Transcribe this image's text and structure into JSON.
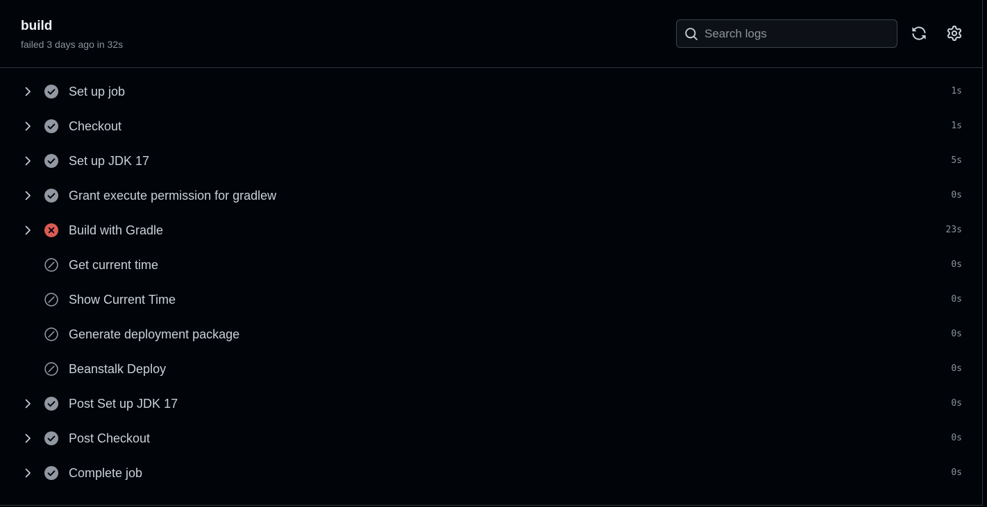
{
  "job": {
    "title": "build",
    "status_text": "failed 3 days ago in 32s"
  },
  "search": {
    "placeholder": "Search logs",
    "value": ""
  },
  "toolbar": {
    "refresh_icon": "sync-icon",
    "settings_icon": "gear-icon"
  },
  "colors": {
    "background": "#010409",
    "success_icon": "#9198a1",
    "failure_icon": "#f85149",
    "skipped_icon": "#9198a1",
    "text": "#c9d1d9",
    "muted": "#8b949e"
  },
  "steps": [
    {
      "name": "Set up job",
      "duration": "1s",
      "status": "success",
      "expandable": true
    },
    {
      "name": "Checkout",
      "duration": "1s",
      "status": "success",
      "expandable": true
    },
    {
      "name": "Set up JDK 17",
      "duration": "5s",
      "status": "success",
      "expandable": true
    },
    {
      "name": "Grant execute permission for gradlew",
      "duration": "0s",
      "status": "success",
      "expandable": true
    },
    {
      "name": "Build with Gradle",
      "duration": "23s",
      "status": "failure",
      "expandable": true
    },
    {
      "name": "Get current time",
      "duration": "0s",
      "status": "skipped",
      "expandable": false
    },
    {
      "name": "Show Current Time",
      "duration": "0s",
      "status": "skipped",
      "expandable": false
    },
    {
      "name": "Generate deployment package",
      "duration": "0s",
      "status": "skipped",
      "expandable": false
    },
    {
      "name": "Beanstalk Deploy",
      "duration": "0s",
      "status": "skipped",
      "expandable": false
    },
    {
      "name": "Post Set up JDK 17",
      "duration": "0s",
      "status": "success",
      "expandable": true
    },
    {
      "name": "Post Checkout",
      "duration": "0s",
      "status": "success",
      "expandable": true
    },
    {
      "name": "Complete job",
      "duration": "0s",
      "status": "success",
      "expandable": true
    }
  ]
}
